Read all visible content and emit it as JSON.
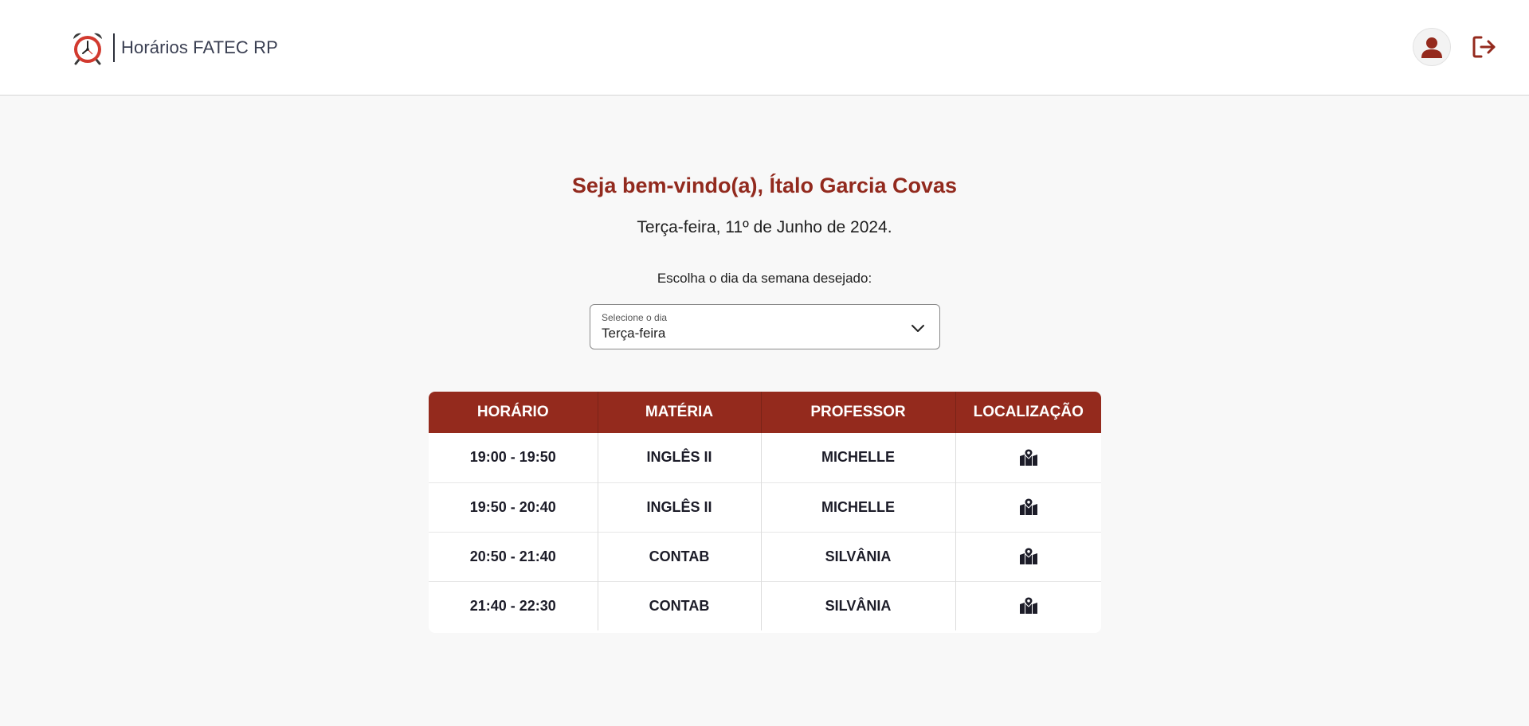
{
  "header": {
    "brand_title": "Horários FATEC RP",
    "logo_icon": "alarm-clock-icon",
    "profile_icon": "user-icon",
    "logout_icon": "logout-icon"
  },
  "welcome": {
    "prefix": "Seja bem-vindo(a),",
    "name": "Ítalo Garcia Covas"
  },
  "date_line": "Terça-feira, 11º de Junho de 2024.",
  "day_picker": {
    "label": "Escolha o dia da semana desejado:",
    "caption": "Selecione o dia",
    "selected": "Terça-feira"
  },
  "schedule": {
    "headers": [
      "HORÁRIO",
      "MATÉRIA",
      "PROFESSOR",
      "LOCALIZAÇÃO"
    ],
    "rows": [
      {
        "time": "19:00 - 19:50",
        "subject": "INGLÊS II",
        "teacher": "MICHELLE"
      },
      {
        "time": "19:50 - 20:40",
        "subject": "INGLÊS II",
        "teacher": "MICHELLE"
      },
      {
        "time": "20:50 - 21:40",
        "subject": "CONTAB",
        "teacher": "SILVÂNIA"
      },
      {
        "time": "21:40 - 22:30",
        "subject": "CONTAB",
        "teacher": "SILVÂNIA"
      }
    ],
    "location_icon": "map-location-icon"
  },
  "colors": {
    "brand_red": "#942a1d",
    "text_dark": "#1c1c28",
    "background": "#f8f8f8"
  }
}
